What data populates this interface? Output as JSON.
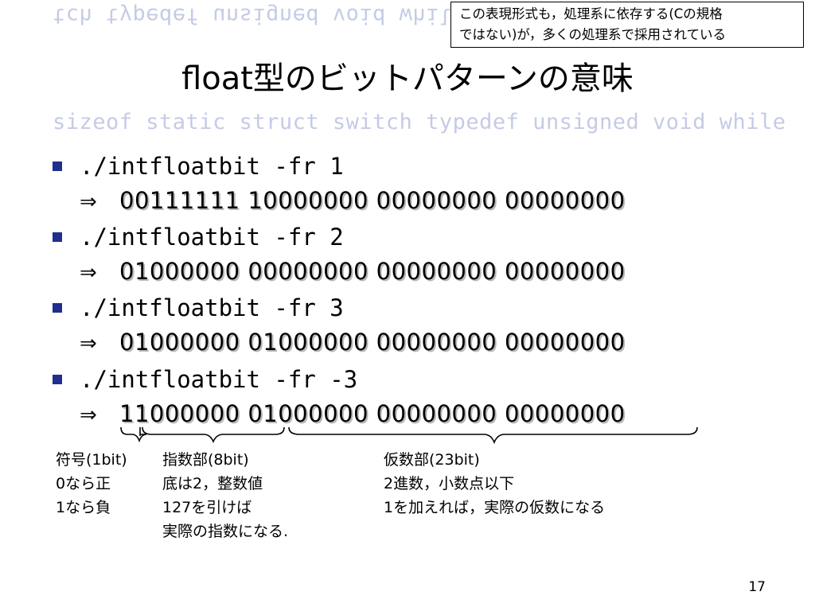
{
  "decor": {
    "keywords_top": "tch typedef unsigned void while",
    "keywords_mid": "sizeof static struct switch typedef unsigned void while"
  },
  "note": {
    "line1": "この表現形式も，処理系に依存する(Cの規格",
    "line2": "ではない)が，多くの処理系で採用されている"
  },
  "title": "float型のビットパターンの意味",
  "items": [
    {
      "command": "./intfloatbit -fr 1",
      "arrow": "⇒",
      "bits": "00111111 10000000 00000000 00000000"
    },
    {
      "command": "./intfloatbit -fr 2",
      "arrow": "⇒",
      "bits": "01000000 00000000 00000000 00000000"
    },
    {
      "command": "./intfloatbit -fr 3",
      "arrow": "⇒",
      "bits": "01000000 01000000 00000000 00000000"
    },
    {
      "command": "./intfloatbit -fr -3",
      "arrow": "⇒",
      "bits": "11000000 01000000 00000000 00000000"
    }
  ],
  "labels": {
    "sign": [
      "符号(1bit)",
      "0なら正",
      "1なら負"
    ],
    "exponent": [
      "指数部(8bit)",
      "底は2，整数値",
      "127を引けば",
      "実際の指数になる."
    ],
    "mantissa": [
      "仮数部(23bit)",
      "2進数，小数点以下",
      "1を加えれば，実際の仮数になる"
    ]
  },
  "page_number": "17"
}
